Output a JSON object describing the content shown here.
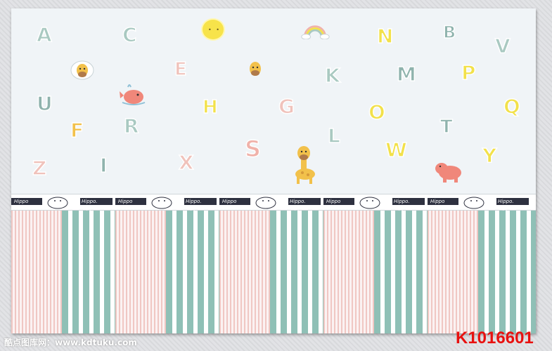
{
  "letters": [
    {
      "char": "A",
      "color": "#a9c9c1"
    },
    {
      "char": "C",
      "color": "#a9c9c1"
    },
    {
      "char": "N",
      "color": "#f2e14b"
    },
    {
      "char": "B",
      "color": "#8fb3ad"
    },
    {
      "char": "V",
      "color": "#a9c9c1"
    },
    {
      "char": "E",
      "color": "#f0c2bb"
    },
    {
      "char": "F",
      "color": "#f2c14b"
    },
    {
      "char": "K",
      "color": "#a9c9c1"
    },
    {
      "char": "M",
      "color": "#8fb3ad"
    },
    {
      "char": "P",
      "color": "#f2e14b"
    },
    {
      "char": "U",
      "color": "#8fb3ad"
    },
    {
      "char": "H",
      "color": "#f2e14b"
    },
    {
      "char": "G",
      "color": "#f0c2bb"
    },
    {
      "char": "O",
      "color": "#f2e14b"
    },
    {
      "char": "Q",
      "color": "#f2e14b"
    },
    {
      "char": "R",
      "color": "#a9c9c1"
    },
    {
      "char": "T",
      "color": "#8fb3ad"
    },
    {
      "char": "Z",
      "color": "#f0c2bb"
    },
    {
      "char": "I",
      "color": "#8fb3ad"
    },
    {
      "char": "X",
      "color": "#f0c2bb"
    },
    {
      "char": "S",
      "color": "#f0b2aa"
    },
    {
      "char": "L",
      "color": "#a9c9c1"
    },
    {
      "char": "W",
      "color": "#f2e14b"
    },
    {
      "char": "Y",
      "color": "#f2e14b"
    }
  ],
  "band": {
    "tag_text": "Hippo. Hippo",
    "tag_short": "Hippo"
  },
  "colors": {
    "pink_stripe": "#f0c7c3",
    "green_stripe": "#8fc0b6",
    "navy": "#2e3140",
    "code_red": "#e8110f"
  },
  "watermark": "酷点图库网：www.kdtuku.com",
  "product_code": "K1016601"
}
